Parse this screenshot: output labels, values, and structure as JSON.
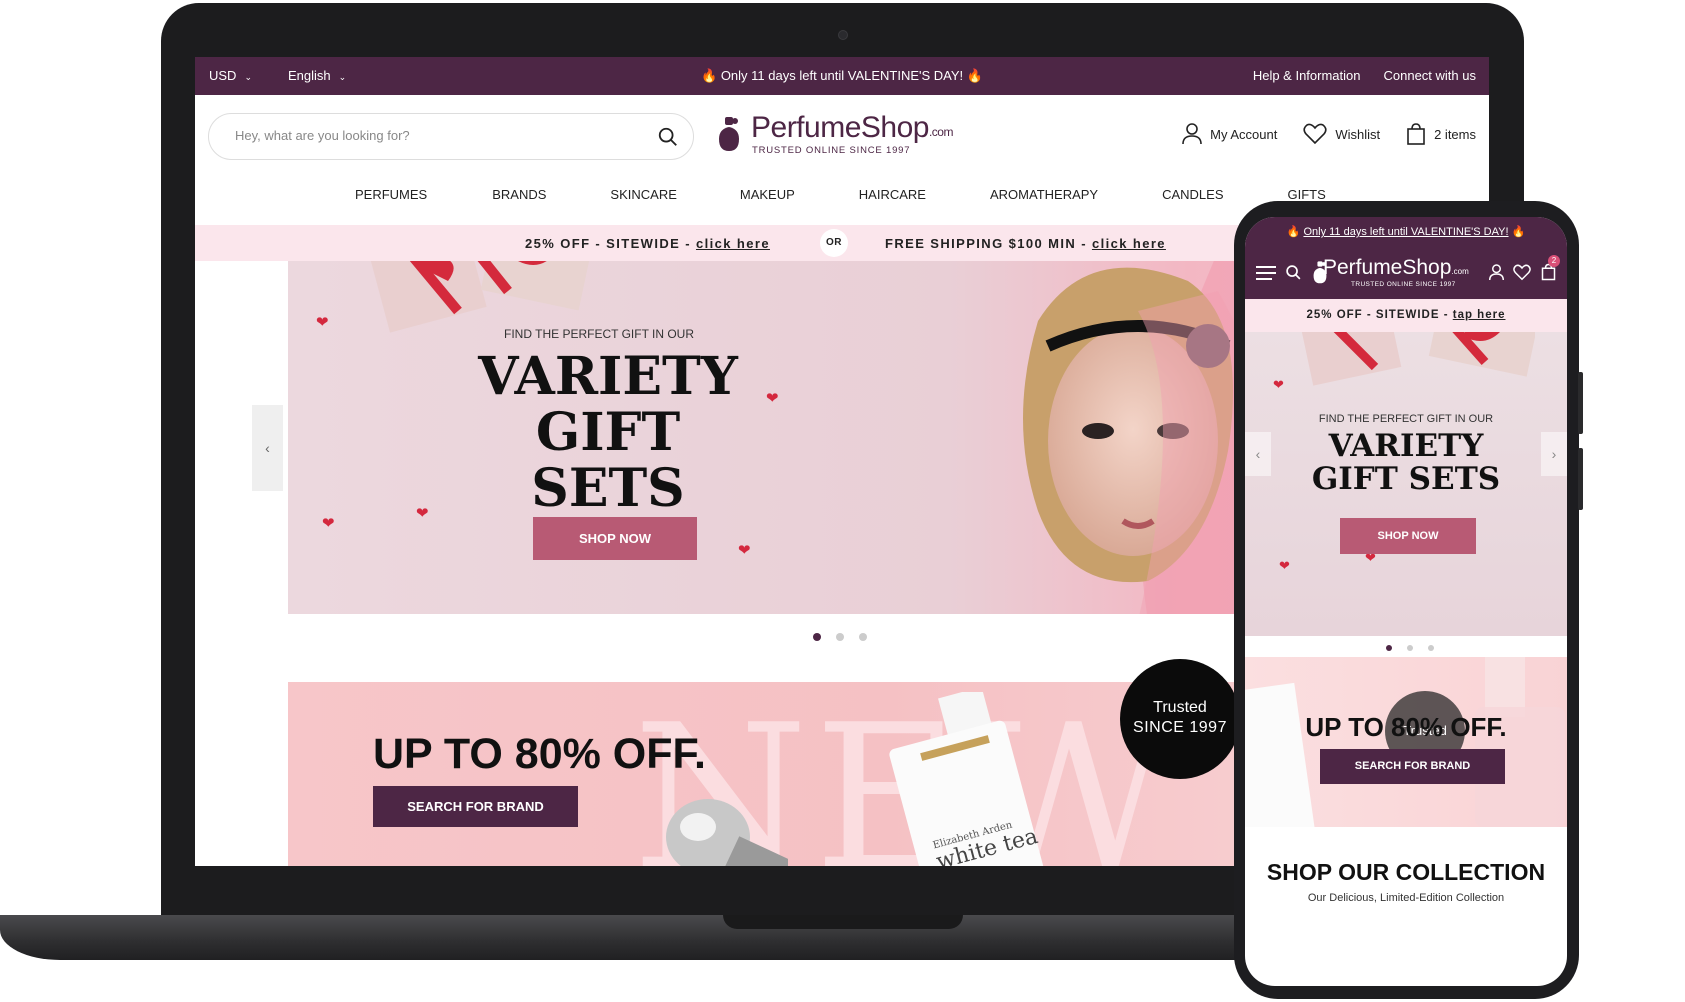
{
  "desktop": {
    "topbar": {
      "currency": "USD",
      "language": "English",
      "announcement": "🔥 Only 11 days left until VALENTINE'S DAY! 🔥",
      "help": "Help & Information",
      "connect": "Connect with us"
    },
    "search": {
      "placeholder": "Hey, what are you looking for?"
    },
    "logo": {
      "name": "PerfumeShop",
      "suffix": ".com",
      "tagline": "TRUSTED ONLINE SINCE 1997"
    },
    "account": {
      "my_account": "My Account",
      "wishlist": "Wishlist",
      "cart": "2 items"
    },
    "nav": [
      "PERFUMES",
      "BRANDS",
      "SKINCARE",
      "MAKEUP",
      "HAIRCARE",
      "AROMATHERAPY",
      "CANDLES",
      "GIFTS"
    ],
    "promo": {
      "left_text": "25% OFF - SITEWIDE - ",
      "left_link": "click here",
      "or": "OR",
      "right_text": "FREE SHIPPING $100 MIN - ",
      "right_link": "click here"
    },
    "hero": {
      "kicker": "FIND THE PERFECT GIFT IN OUR",
      "title_line1": "VARIETY",
      "title_line2": "GIFT SETS",
      "cta": "SHOP NOW",
      "slides_total": 3,
      "active_slide": 1
    },
    "banner2": {
      "watermark": "NEW",
      "headline": "UP TO 80% OFF.",
      "cta": "SEARCH FOR BRAND",
      "product_brand": "Elizabeth Arden",
      "product_name": "white tea"
    },
    "trusted": {
      "line1": "Trusted",
      "line2": "SINCE 1997"
    }
  },
  "mobile": {
    "topbar": {
      "announcement": "Only 11 days left until VALENTINE'S DAY!",
      "flame": "🔥"
    },
    "logo": {
      "name": "PerfumeShop",
      "suffix": ".com",
      "tagline": "TRUSTED ONLINE SINCE 1997"
    },
    "cart_count": "2",
    "promo": {
      "text": "25% OFF - SITEWIDE - ",
      "link": "tap here"
    },
    "hero": {
      "kicker": "FIND THE PERFECT GIFT IN OUR",
      "title_line1": "VARIETY",
      "title_line2": "GIFT SETS",
      "cta": "SHOP NOW"
    },
    "banner2": {
      "headline": "UP TO 80% OFF.",
      "cta": "SEARCH FOR BRAND",
      "trusted": "Trusted"
    },
    "collection": {
      "title": "SHOP OUR COLLECTION",
      "subtitle": "Our Delicious, Limited-Edition Collection"
    }
  },
  "colors": {
    "brand": "#4d2645",
    "accent": "#b85a74",
    "promo_bg": "#fbe6ec"
  }
}
